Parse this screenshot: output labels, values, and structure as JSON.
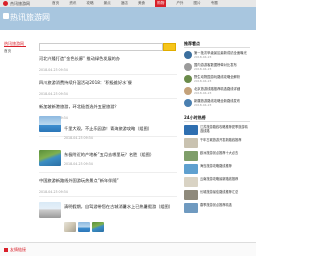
{
  "brand": {
    "text": "杰讯旅游网"
  },
  "nav": [
    "首页",
    "资讯",
    "攻略",
    "景点",
    "酒店",
    "美食",
    "购物",
    "户外",
    "图片",
    "专题"
  ],
  "nav_active_index": 6,
  "site": {
    "title": "热讯旅游网"
  },
  "left": {
    "title": "热讯旅游网",
    "sub": "首页"
  },
  "search": {
    "placeholder": ""
  },
  "main": {
    "items": [
      {
        "title": "河北兴隆打造“金色长廊” 推动绿色发展的办",
        "meta": "2018-04-23 09:34"
      },
      {
        "title": "四川旅游消费持续升温活动2018：‘积极维好水’餐",
        "meta": "2018-04-23 09:34"
      },
      {
        "title": "新加坡新港旅游，环北极首选外五星旅游？",
        "meta": "2018-04-23 09:34"
      },
      {
        "title": "千里大观，不止乐园游！青海旅游攻略（组图）",
        "meta": "2018-04-23 09:34"
      },
      {
        "title": "东极附近的产地新”五月去哪里玩？名胜（组图）",
        "meta": "2018-04-23 09:34"
      },
      {
        "title": "中国旅游新路线外国游玩热景点”新年伴随”",
        "meta": "2018-04-23 09:34"
      },
      {
        "title": "清明假期，自驾游带您在古城消暑水上已热暑假游（组图）",
        "meta": "2018-04-23 09:34"
      }
    ]
  },
  "side": {
    "header1": "推荐看点",
    "recommend": [
      {
        "title": "第一批次甲级景区最新成绩全面曝光",
        "sub": "2018-04-23"
      },
      {
        "title": "国内游游客数据榜单对比发布",
        "sub": "2018-04-23"
      },
      {
        "title": "野生动物园游玩路线攻略全解析",
        "sub": "2018-04-23"
      },
      {
        "title": "北京旅游线路推荐精选路线详细",
        "sub": "2018-04-23"
      },
      {
        "title": "新疆旅游路线攻略全新路线发布",
        "sub": "2018-04-23"
      }
    ],
    "header2": "24小时热榜",
    "hot": [
      {
        "title": "江苏旅游路线攻略推荐夏季旅游精选线路"
      },
      {
        "title": "千年古城旅游开发新路线推荐"
      },
      {
        "title": "欧洲旅游景点推荐十大必去"
      },
      {
        "title": "海岛旅游攻略路线推荐"
      },
      {
        "title": "云南旅游攻略最新路线推荐"
      },
      {
        "title": "长城旅游最佳路线推荐汇总"
      },
      {
        "title": "春季旅游景点推荐精选"
      }
    ]
  },
  "footer": {
    "label": "友情链接"
  },
  "colors": {
    "accent": "#d9202a",
    "header": "#a8c6df",
    "search_button": "#f6c51b"
  }
}
